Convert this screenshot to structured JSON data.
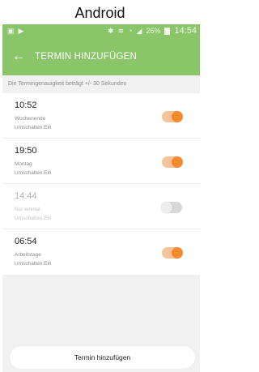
{
  "device_label": "Android",
  "status_bar": {
    "time": "14:54",
    "battery": "26%",
    "icons": [
      "screenshot-icon",
      "play-icon",
      "bluetooth-icon",
      "vibrate-icon",
      "wifi-icon",
      "signal-icon",
      "battery-icon"
    ]
  },
  "header": {
    "back_icon": "←",
    "title": "TERMIN HINZUFÜGEN"
  },
  "hint": "Die Termingenauigkeit beträgt +/- 30 Sekunden",
  "alarms": [
    {
      "time": "10:52",
      "days": "Wochenende",
      "status": "Umschalten:Ein",
      "enabled": true
    },
    {
      "time": "19:50",
      "days": "Montag",
      "status": "Umschalten:Ein",
      "enabled": true
    },
    {
      "time": "14:44",
      "days": "Nur einmal",
      "status": "Umschalten:Ein",
      "enabled": false
    },
    {
      "time": "06:54",
      "days": "Arbeitstage",
      "status": "Umschalten:Ein",
      "enabled": true
    }
  ],
  "add_button": "Termin hinzufügen",
  "colors": {
    "accent_green": "#8bc56a",
    "toggle_on": "#f58a2a",
    "toggle_off": "#d8d8d8"
  }
}
